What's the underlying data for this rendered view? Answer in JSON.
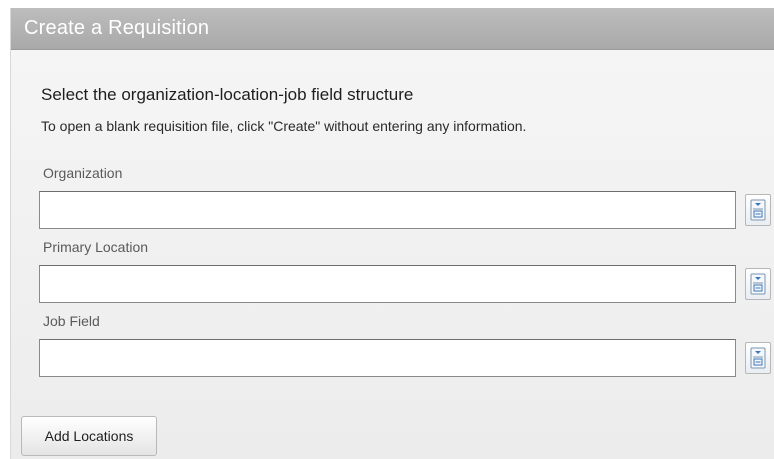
{
  "dialog": {
    "title": "Create a Requisition",
    "heading": "Select the organization-location-job field structure",
    "instruction": "To open a blank requisition file, click \"Create\" without entering any information."
  },
  "fields": [
    {
      "label": "Organization",
      "value": "",
      "selector_icon": "lookup-selector-icon"
    },
    {
      "label": "Primary Location",
      "value": "",
      "selector_icon": "lookup-selector-icon"
    },
    {
      "label": "Job Field",
      "value": "",
      "selector_icon": "lookup-selector-icon"
    }
  ],
  "actions": {
    "add_locations_label": "Add Locations"
  },
  "colors": {
    "titlebar": "#b3b3b3",
    "panel": "#f1f1f1",
    "selector_accent": "#3a76b8"
  }
}
